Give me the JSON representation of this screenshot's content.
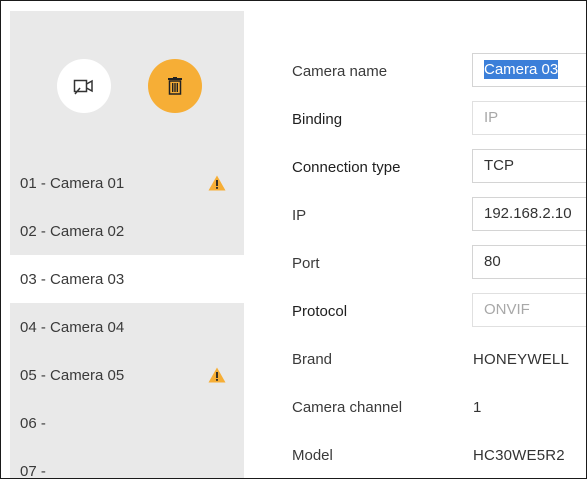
{
  "toolbar": {
    "add_camera_icon": "camera-add-icon",
    "delete_icon": "trash-icon",
    "delete_color": "#f6ae36"
  },
  "cameras": [
    {
      "label": "01 - Camera 01",
      "warning": true,
      "selected": false
    },
    {
      "label": "02 - Camera 02",
      "warning": false,
      "selected": false
    },
    {
      "label": "03 - Camera 03",
      "warning": false,
      "selected": true
    },
    {
      "label": "04 - Camera 04",
      "warning": false,
      "selected": false
    },
    {
      "label": "05 - Camera 05",
      "warning": true,
      "selected": false
    },
    {
      "label": "06 -",
      "warning": false,
      "selected": false
    },
    {
      "label": "07 -",
      "warning": false,
      "selected": false
    }
  ],
  "form": {
    "camera_name": {
      "label": "Camera name",
      "value": "Camera 03"
    },
    "binding": {
      "label": "Binding",
      "value": "IP"
    },
    "connection_type": {
      "label": "Connection type",
      "value": "TCP"
    },
    "ip": {
      "label": "IP",
      "value": "192.168.2.10"
    },
    "port": {
      "label": "Port",
      "value": "80"
    },
    "protocol": {
      "label": "Protocol",
      "value": "ONVIF"
    },
    "brand": {
      "label": "Brand",
      "value": "HONEYWELL"
    },
    "camera_channel": {
      "label": "Camera channel",
      "value": "1"
    },
    "model": {
      "label": "Model",
      "value": "HC30WE5R2"
    }
  },
  "colors": {
    "sidebar_bg": "#e9e9e9",
    "accent": "#f6ae36",
    "warning": "#f6ae36",
    "selection": "#3b7fd9"
  }
}
